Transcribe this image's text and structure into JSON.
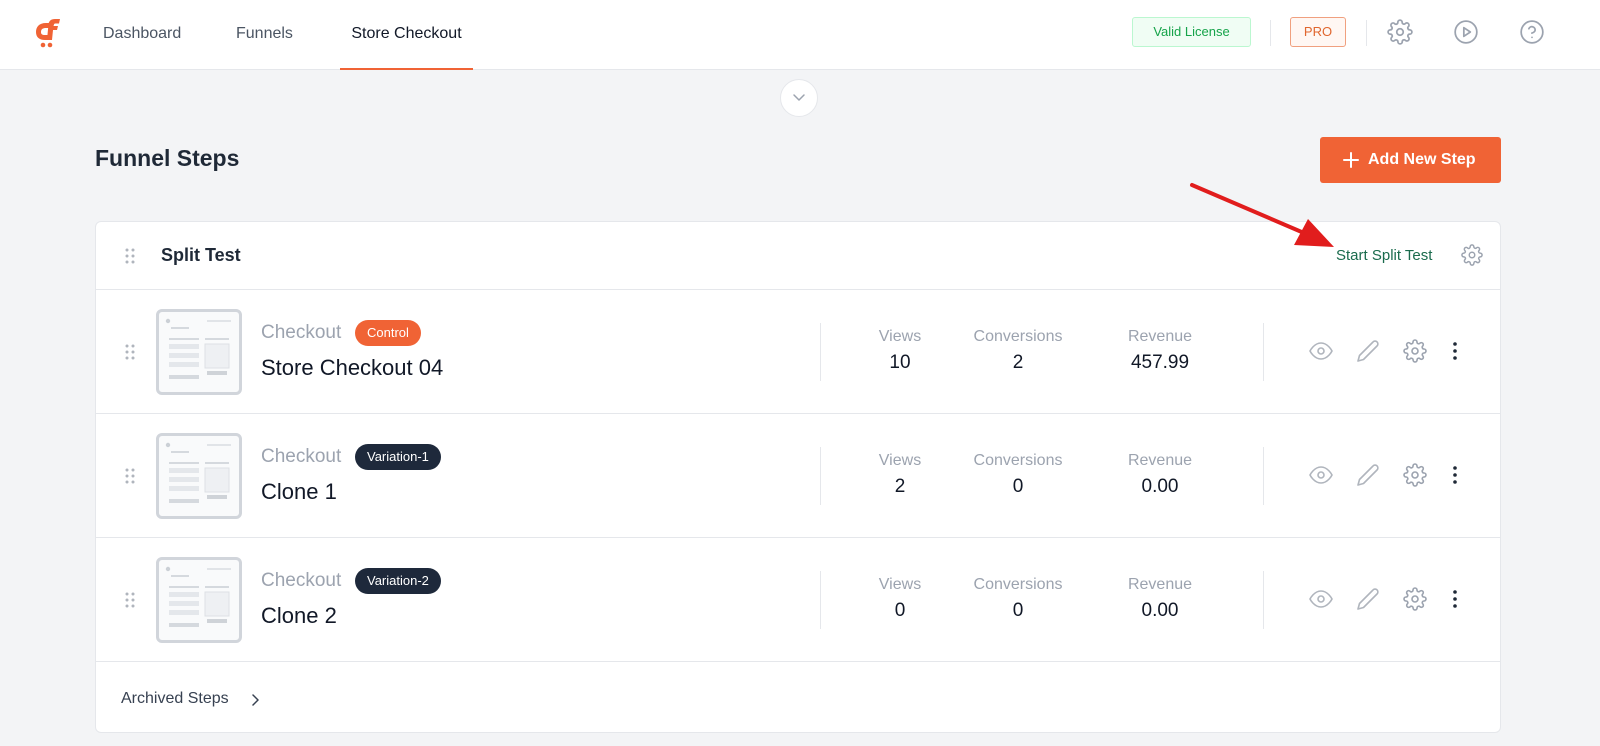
{
  "nav": {
    "items": [
      {
        "label": "Dashboard"
      },
      {
        "label": "Funnels"
      },
      {
        "label": "Store Checkout"
      }
    ],
    "license_label": "Valid License",
    "pro_label": "PRO"
  },
  "page": {
    "title": "Funnel Steps",
    "add_button_label": "Add New Step"
  },
  "split_test": {
    "title": "Split Test",
    "start_label": "Start Split Test",
    "stat_labels": {
      "views": "Views",
      "conversions": "Conversions",
      "revenue": "Revenue"
    },
    "steps": [
      {
        "type": "Checkout",
        "badge": "Control",
        "name": "Store Checkout 04",
        "views": "10",
        "conversions": "2",
        "revenue": "457.99"
      },
      {
        "type": "Checkout",
        "badge": "Variation-1",
        "name": "Clone 1",
        "views": "2",
        "conversions": "0",
        "revenue": "0.00"
      },
      {
        "type": "Checkout",
        "badge": "Variation-2",
        "name": "Clone 2",
        "views": "0",
        "conversions": "0",
        "revenue": "0.00"
      }
    ],
    "archived_label": "Archived Steps"
  },
  "colors": {
    "accent": "#f06335",
    "valid_license": "#16a34a",
    "start_split": "#1a6b4d",
    "variation_badge": "#1e293b",
    "annotation_arrow": "#e11d1d"
  },
  "icons": [
    "cartflows-logo-icon",
    "settings-gear-icon",
    "play-circle-icon",
    "help-circle-icon",
    "chevron-down-icon",
    "plus-icon",
    "drag-handle-icon",
    "eye-icon",
    "pencil-icon",
    "more-vertical-icon",
    "chevron-right-icon",
    "red-annotation-arrow-icon"
  ]
}
